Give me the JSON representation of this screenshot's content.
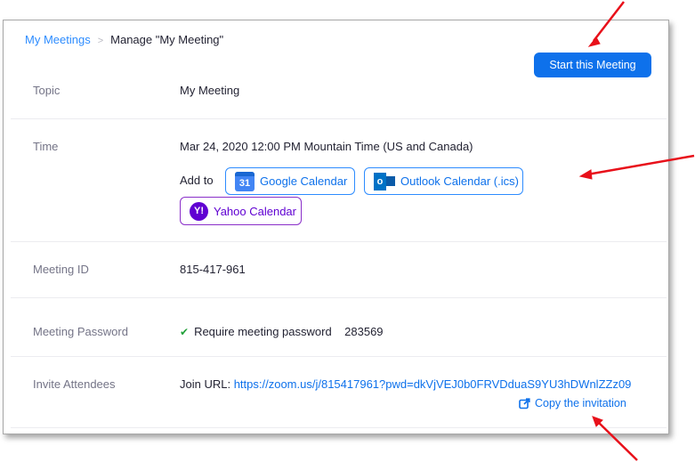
{
  "breadcrumb": {
    "parent": "My Meetings",
    "separator": ">",
    "current": "Manage \"My Meeting\""
  },
  "start_button": "Start this Meeting",
  "rows": {
    "topic": {
      "label": "Topic",
      "value": "My Meeting"
    },
    "time": {
      "label": "Time",
      "value": "Mar 24, 2020 12:00 PM Mountain Time (US and Canada)",
      "add_to": "Add to",
      "google": "Google Calendar",
      "google_icon_text": "31",
      "outlook": "Outlook Calendar (.ics)",
      "outlook_icon_text": "o",
      "yahoo": "Yahoo Calendar",
      "yahoo_icon_text": "Y!"
    },
    "meeting_id": {
      "label": "Meeting ID",
      "value": "815-417-961"
    },
    "password": {
      "label": "Meeting Password",
      "require_text": "Require meeting password",
      "value": "283569"
    },
    "invite": {
      "label": "Invite Attendees",
      "join_label": "Join URL:",
      "join_url": "https://zoom.us/j/815417961?pwd=dkVjVEJ0b0FRVDduaS9YU3hDWnlZZz09",
      "copy": "Copy the invitation"
    }
  },
  "colors": {
    "accent": "#0e71eb",
    "annotation_arrow": "#e8101a",
    "yahoo": "#6001d2"
  }
}
